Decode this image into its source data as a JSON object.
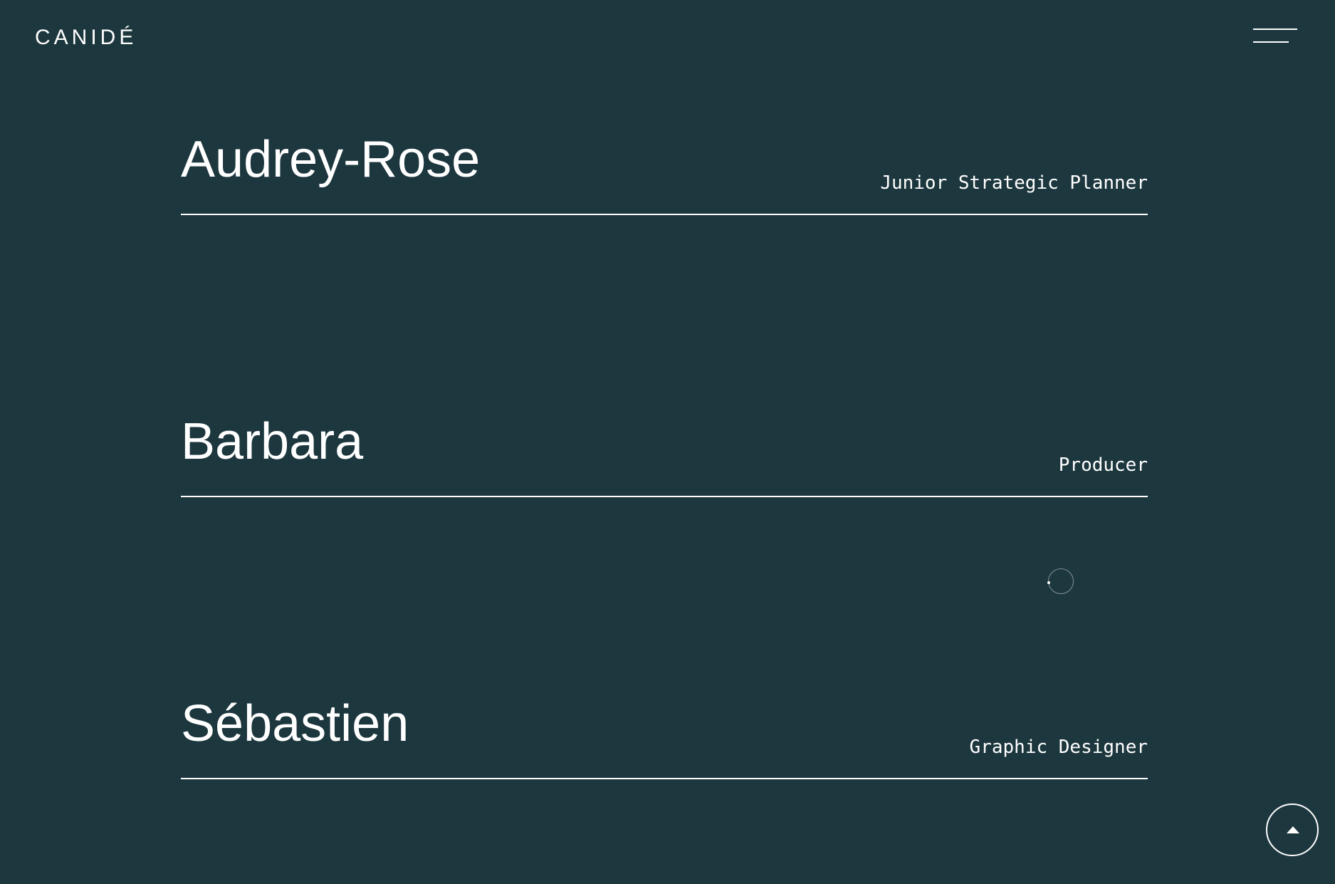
{
  "header": {
    "logo_text": "CANIDÉ",
    "menu_icon": "hamburger-menu-icon"
  },
  "team": [
    {
      "name": "Audrey-Rose",
      "role": "Junior Strategic Planner"
    },
    {
      "name": "Barbara",
      "role": "Producer"
    },
    {
      "name": "Sébastien",
      "role": "Graphic Designer"
    }
  ],
  "scroll_top": {
    "icon": "arrow-up-icon"
  },
  "colors": {
    "background": "#1d373e",
    "foreground": "#ffffff"
  }
}
